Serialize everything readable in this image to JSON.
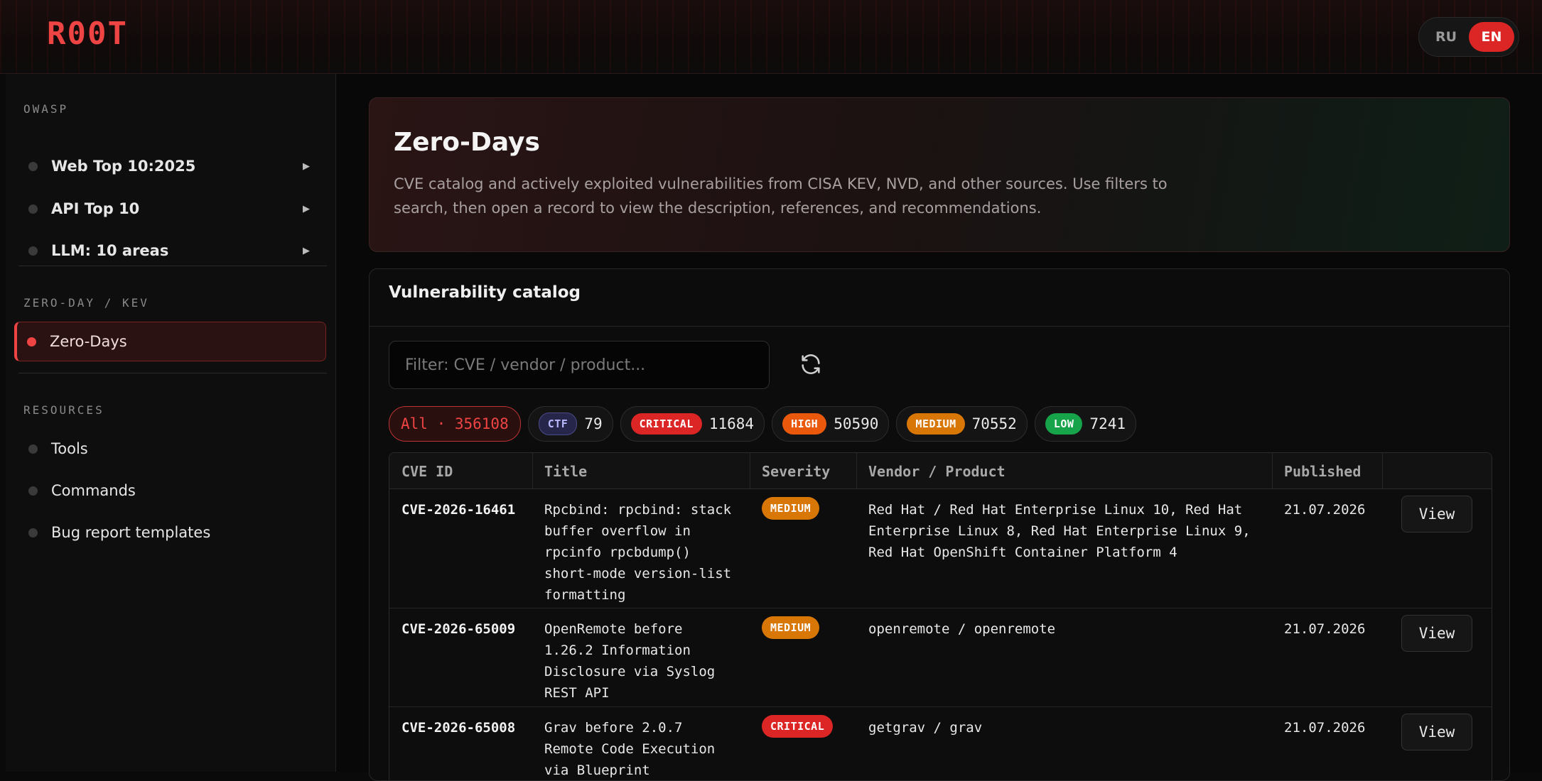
{
  "header": {
    "logo": "R00T",
    "lang_ru": "RU",
    "lang_en": "EN"
  },
  "sidebar": {
    "owasp_title": "OWASP",
    "owasp_items": [
      {
        "label": "Web Top 10:2025"
      },
      {
        "label": "API Top 10"
      },
      {
        "label": "LLM: 10 areas"
      }
    ],
    "zeroday_title": "ZERO-DAY / KEV",
    "zeroday_item": "Zero-Days",
    "resources_title": "RESOURCES",
    "resources_items": [
      {
        "label": "Tools"
      },
      {
        "label": "Commands"
      },
      {
        "label": "Bug report templates"
      }
    ]
  },
  "hero": {
    "title": "Zero-Days",
    "description": "CVE catalog and actively exploited vulnerabilities from CISA KEV, NVD, and other sources. Use filters to search, then open a record to view the description, references, and recommendations."
  },
  "catalog": {
    "title": "Vulnerability catalog",
    "filter_placeholder": "Filter: CVE / vendor / product...",
    "chips": {
      "all": "All · 356108",
      "ctf_label": "CTF",
      "ctf_count": "79",
      "critical_label": "CRITICAL",
      "critical_count": "11684",
      "high_label": "HIGH",
      "high_count": "50590",
      "medium_label": "MEDIUM",
      "medium_count": "70552",
      "low_label": "LOW",
      "low_count": "7241"
    },
    "columns": [
      "CVE ID",
      "Title",
      "Severity",
      "Vendor / Product",
      "Published",
      ""
    ],
    "rows": [
      {
        "cve": "CVE-2026-16461",
        "title": "Rpcbind: rpcbind: stack buffer overflow in rpcinfo rpcbdump() short-mode version-list formatting",
        "severity": "MEDIUM",
        "vendor": "Red Hat / Red Hat Enterprise Linux 10, Red Hat Enterprise Linux 8, Red Hat Enterprise Linux 9, Red Hat OpenShift Container Platform 4",
        "published": "21.07.2026",
        "action": "View"
      },
      {
        "cve": "CVE-2026-65009",
        "title": "OpenRemote before 1.26.2 Information Disclosure via Syslog REST API",
        "severity": "MEDIUM",
        "vendor": "openremote / openremote",
        "published": "21.07.2026",
        "action": "View"
      },
      {
        "cve": "CVE-2026-65008",
        "title": "Grav before 2.0.7 Remote Code Execution via Blueprint",
        "severity": "CRITICAL",
        "vendor": "getgrav / grav",
        "published": "21.07.2026",
        "action": "View"
      }
    ]
  },
  "colors": {
    "accent": "#ef4444",
    "critical": "#dc2626",
    "high": "#ea580c",
    "medium": "#d97706",
    "low": "#16a34a"
  }
}
